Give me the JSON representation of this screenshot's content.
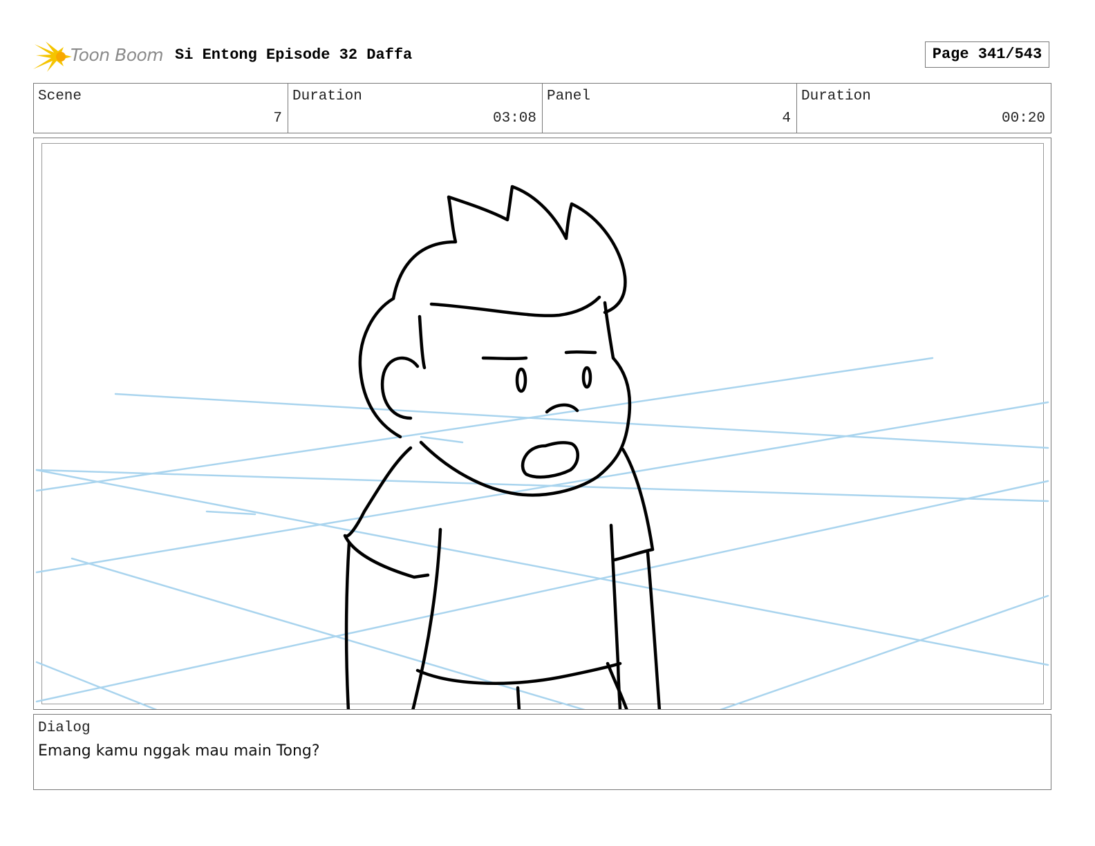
{
  "header": {
    "logo_text": "Toon Boom",
    "title": "Si Entong Episode 32 Daffa",
    "page": "Page 341/543"
  },
  "info": {
    "scene_label": "Scene",
    "scene_value": "7",
    "scene_duration_label": "Duration",
    "scene_duration_value": "03:08",
    "panel_label": "Panel",
    "panel_value": "4",
    "panel_duration_label": "Duration",
    "panel_duration_value": "00:20"
  },
  "dialog": {
    "label": "Dialog",
    "text": "Emang kamu nggak mau main Tong?"
  },
  "colors": {
    "sketch_lines": "#000000",
    "guide_lines": "#a9d4ee",
    "logo_star": "#f5c400"
  }
}
